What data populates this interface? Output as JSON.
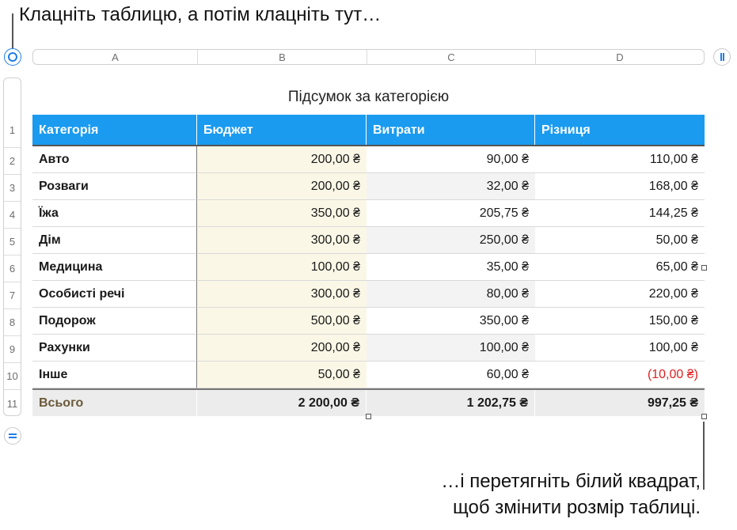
{
  "callouts": {
    "top": "Клацніть таблицю, а потім клацніть тут…",
    "bottom_line1": "…і перетягніть білий квадрат,",
    "bottom_line2": "щоб змінити розмір таблиці."
  },
  "column_headers": [
    "A",
    "B",
    "C",
    "D"
  ],
  "row_numbers": [
    "1",
    "2",
    "3",
    "4",
    "5",
    "6",
    "7",
    "8",
    "9",
    "10",
    "11"
  ],
  "table": {
    "title": "Підсумок за категорією",
    "header": [
      "Категорія",
      "Бюджет",
      "Витрати",
      "Різниця"
    ],
    "rows": [
      [
        "Авто",
        "200,00 ₴",
        "90,00 ₴",
        "110,00 ₴"
      ],
      [
        "Розваги",
        "200,00 ₴",
        "32,00 ₴",
        "168,00 ₴"
      ],
      [
        "Їжа",
        "350,00 ₴",
        "205,75 ₴",
        "144,25 ₴"
      ],
      [
        "Дім",
        "300,00 ₴",
        "250,00 ₴",
        "50,00 ₴"
      ],
      [
        "Медицина",
        "100,00 ₴",
        "35,00 ₴",
        "65,00 ₴"
      ],
      [
        "Особисті речі",
        "300,00 ₴",
        "80,00 ₴",
        "220,00 ₴"
      ],
      [
        "Подорож",
        "500,00 ₴",
        "350,00 ₴",
        "150,00 ₴"
      ],
      [
        "Рахунки",
        "200,00 ₴",
        "100,00 ₴",
        "100,00 ₴"
      ],
      [
        "Інше",
        "50,00 ₴",
        "60,00 ₴",
        "(10,00 ₴)"
      ]
    ],
    "footer": [
      "Всього",
      "2 200,00 ₴",
      "1 202,75 ₴",
      "997,25 ₴"
    ]
  },
  "colors": {
    "header_bg": "#1a9bf0",
    "budget_col_bg": "#fbf7e6",
    "negative": "#e02020",
    "accent": "#1f7de8"
  }
}
